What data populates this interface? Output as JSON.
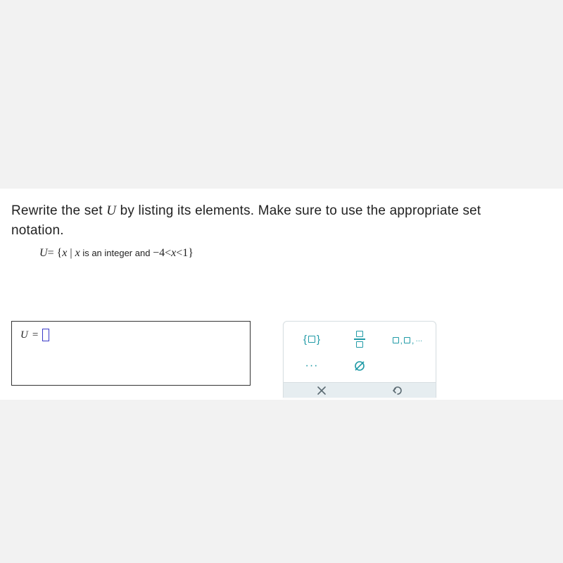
{
  "prompt": {
    "line1_a": "Rewrite the set ",
    "line1_U": "U",
    "line1_b": " by listing its elements. Make sure to use the appropriate set",
    "line2": "notation."
  },
  "set_definition": {
    "U": "U",
    "eq": "=",
    "lbrace": "{",
    "x1": "x",
    "bar": " | ",
    "x2": "x",
    "text": " is an integer and ",
    "lo": "−4",
    "lt1": "<",
    "x3": "x",
    "lt2": "<",
    "hi": "1",
    "rbrace": "}"
  },
  "answer": {
    "lhs": "U",
    "eq": " = "
  },
  "palette": {
    "set_braces": "set-braces",
    "fraction": "fraction",
    "sequence": "sequence-comma",
    "ellipsis_label": "···",
    "empty_set": "empty-set",
    "clear": "clear",
    "undo": "undo"
  }
}
